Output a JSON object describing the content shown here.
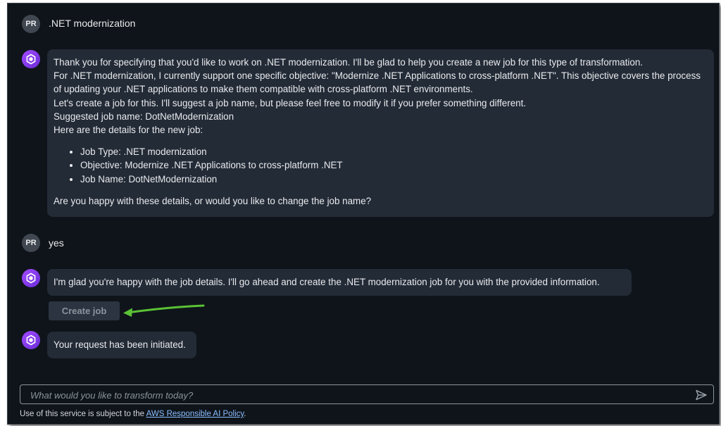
{
  "conversation": {
    "user_initials": "PR",
    "msg1_user": ".NET modernization",
    "msg2_bot": {
      "line1": "Thank you for specifying that you'd like to work on .NET modernization. I'll be glad to help you create a new job for this type of transformation.",
      "line2": "For .NET modernization, I currently support one specific objective: \"Modernize .NET Applications to cross-platform .NET\". This objective covers the process of updating your .NET applications to make them compatible with cross-platform .NET environments.",
      "line3": "Let's create a job for this. I'll suggest a job name, but please feel free to modify it if you prefer something different.",
      "line4": "Suggested job name: DotNetModernization",
      "line5": "Here are the details for the new job:",
      "bullets": [
        "Job Type: .NET modernization",
        "Objective: Modernize .NET Applications to cross-platform .NET",
        "Job Name: DotNetModernization"
      ],
      "closing": "Are you happy with these details, or would you like to change the job name?"
    },
    "msg3_user": "yes",
    "msg4_bot": "I'm glad you're happy with the job details. I'll go ahead and create the .NET modernization job for you with the provided information.",
    "create_job_label": "Create job",
    "msg5_bot": "Your request has been initiated."
  },
  "input": {
    "placeholder": "What would you like to transform today?"
  },
  "footer": {
    "prefix": "Use of this service is subject to the ",
    "link": "AWS Responsible AI Policy",
    "suffix": "."
  },
  "colors": {
    "background": "#0f141a",
    "bubble": "#232b37",
    "accent_arrow": "#5bc236",
    "bot_avatar": "#8a3ff0",
    "link": "#89bdff"
  },
  "icons": [
    "bot-logo-icon",
    "send-icon",
    "annotation-arrow"
  ]
}
